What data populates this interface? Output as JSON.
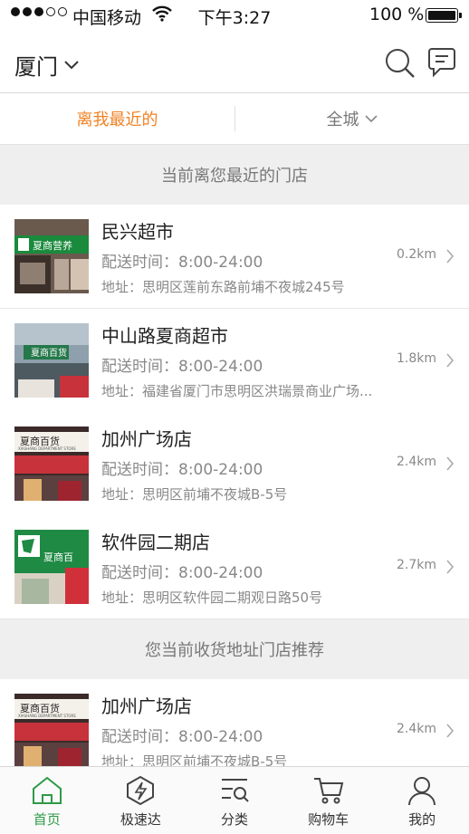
{
  "status_bar": {
    "carrier": "中国移动",
    "time": "下午3:27",
    "battery": "100 %",
    "icons": [
      "signal-dots-icon",
      "wifi-icon",
      "battery-icon"
    ]
  },
  "header": {
    "city": "厦门",
    "icons": [
      "chevron-down-icon",
      "search-icon",
      "message-icon"
    ]
  },
  "filters": {
    "nearest": "离我最近的",
    "area": "全城"
  },
  "sections": {
    "nearest_title": "当前离您最近的门店",
    "recommend_title": "您当前收货地址门店推荐"
  },
  "stores": [
    {
      "name": "民兴超市",
      "hours": "配送时间：8:00-24:00",
      "address": "地址：思明区莲前东路前埔不夜城245号",
      "distance": "0.2km",
      "sign": "夏商营养"
    },
    {
      "name": "中山路夏商超市",
      "hours": "配送时间：8:00-24:00",
      "address": "地址：福建省厦门市思明区洪瑞景商业广场...",
      "distance": "1.8km",
      "sign": "夏商百货"
    },
    {
      "name": "加州广场店",
      "hours": "配送时间：8:00-24:00",
      "address": "地址：思明区前埔不夜城B-5号",
      "distance": "2.4km",
      "sign": "夏商百货",
      "sign_sub": "XIASHANG DEPARTMENT STORE"
    },
    {
      "name": "软件园二期店",
      "hours": "配送时间：8:00-24:00",
      "address": "地址：思明区软件园二期观日路50号",
      "distance": "2.7km",
      "sign": "夏商百"
    }
  ],
  "recommended": [
    {
      "name": "加州广场店",
      "hours": "配送时间：8:00-24:00",
      "address": "地址：思明区前埔不夜城B-5号",
      "distance": "2.4km",
      "sign": "夏商百货",
      "sign_sub": "XIASHANG DEPARTMENT STORE"
    }
  ],
  "tabbar": [
    {
      "label": "首页",
      "icon": "home-icon",
      "active": true
    },
    {
      "label": "极速达",
      "icon": "lightning-icon",
      "active": false
    },
    {
      "label": "分类",
      "icon": "category-icon",
      "active": false
    },
    {
      "label": "购物车",
      "icon": "cart-icon",
      "active": false
    },
    {
      "label": "我的",
      "icon": "user-icon",
      "active": false
    }
  ],
  "colors": {
    "accent_orange": "#f08224",
    "tab_active_green": "#2e9a47",
    "section_bg": "#efefef"
  }
}
